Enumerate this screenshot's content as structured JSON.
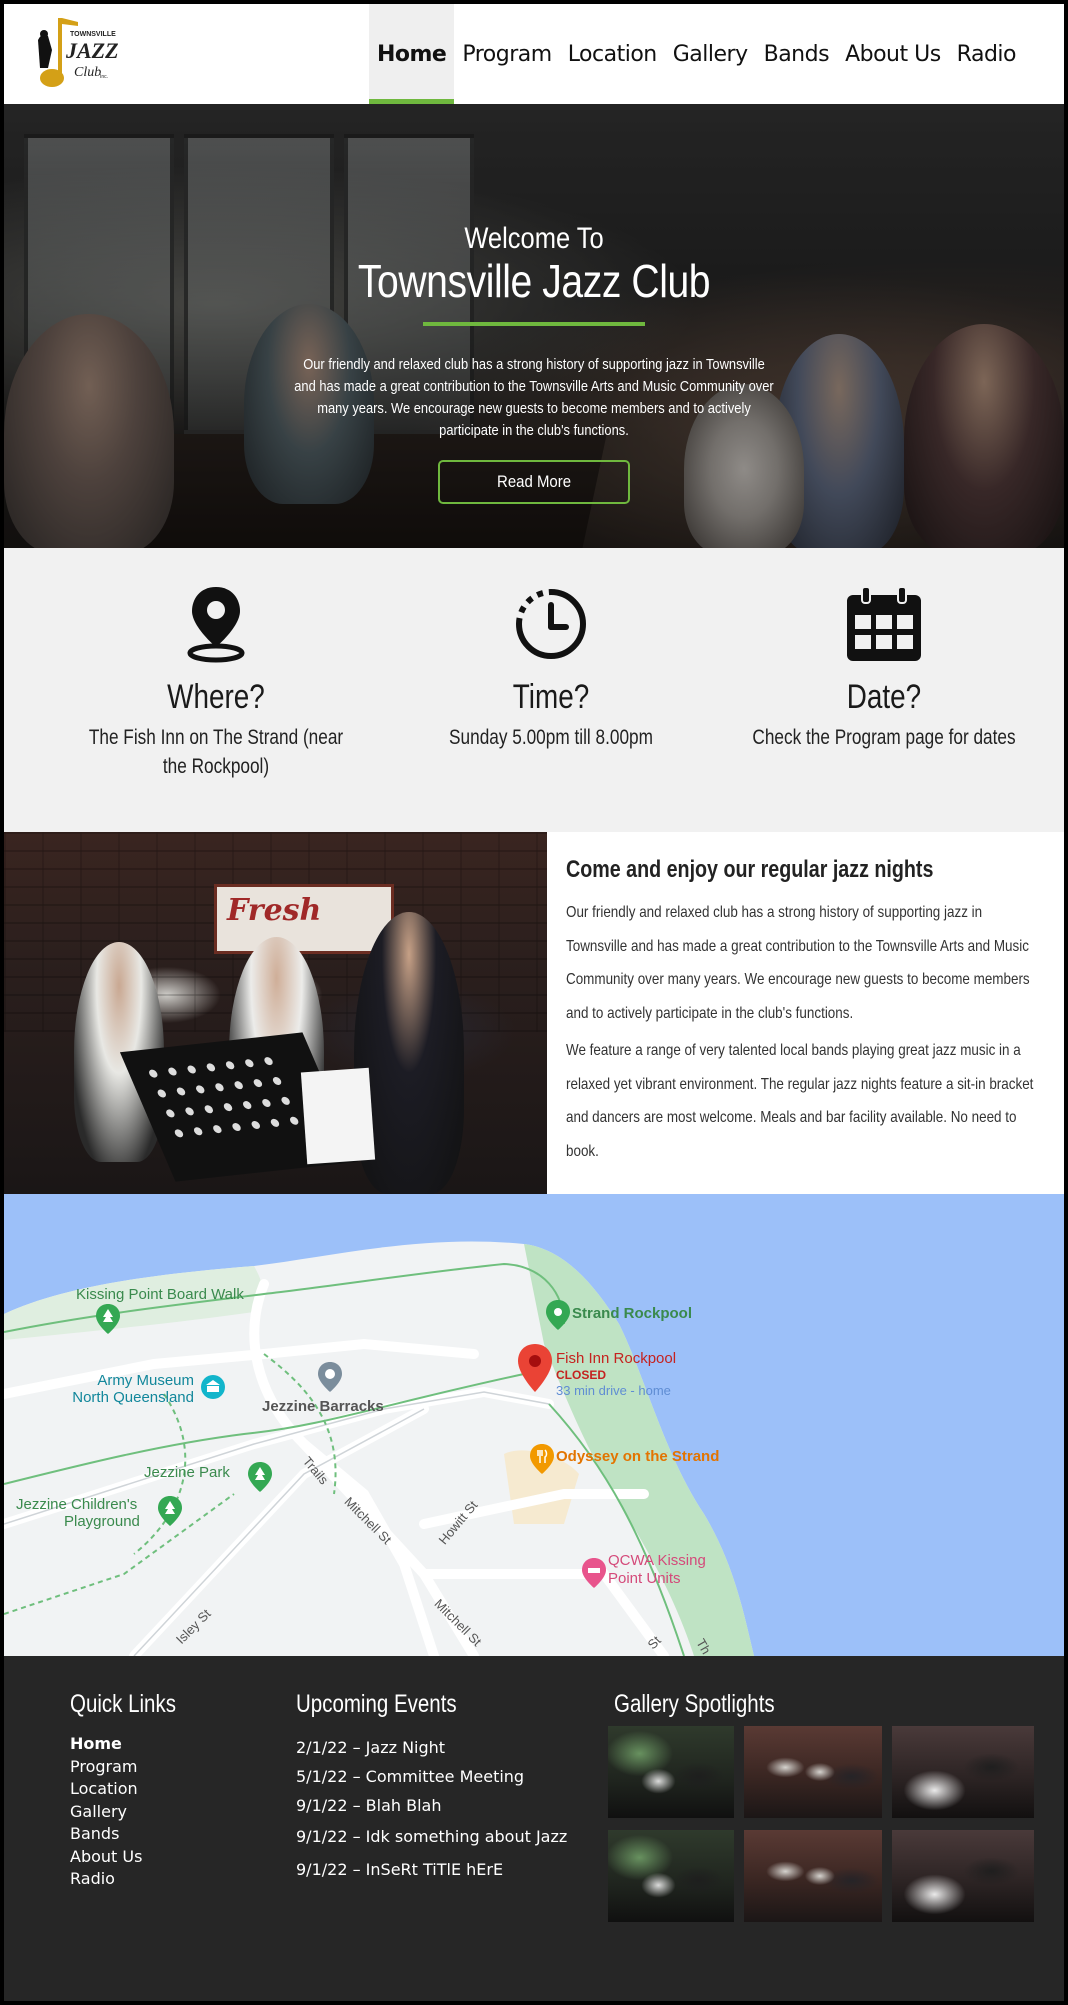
{
  "brand": {
    "logo_top": "TOWNSVILLE",
    "logo_main": "JAZZ",
    "logo_sub": "Club",
    "logo_inc": "Inc."
  },
  "nav": {
    "items": [
      {
        "label": "Home",
        "active": true
      },
      {
        "label": "Program"
      },
      {
        "label": "Location"
      },
      {
        "label": "Gallery"
      },
      {
        "label": "Bands"
      },
      {
        "label": "About Us"
      },
      {
        "label": "Radio"
      }
    ]
  },
  "hero": {
    "kicker": "Welcome To",
    "title": "Townsville Jazz Club",
    "text": "Our friendly and relaxed club has a strong history of supporting jazz in Townsville and has made a great contribution to the Townsville Arts and Music Community over many years.  We encourage new guests to become members and to actively participate in the club's functions.",
    "button": "Read More"
  },
  "info": [
    {
      "icon": "location-pin-icon",
      "title": "Where?",
      "text": "The Fish Inn on The Strand (near the Rockpool)"
    },
    {
      "icon": "clock-icon",
      "title": "Time?",
      "text": "Sunday 5.00pm till 8.00pm"
    },
    {
      "icon": "calendar-icon",
      "title": "Date?",
      "text": "Check the Program page for dates"
    }
  ],
  "feature": {
    "sign": "Fresh",
    "heading": "Come and enjoy our regular jazz nights",
    "para1": "Our friendly and relaxed club has a strong history of supporting jazz in Townsville and has made a great contribution to the Townsville Arts and Music Community over many years.  We encourage new guests to become members and to actively participate in the club's functions.",
    "para2": "We feature a range of very talented local bands playing great jazz music in a relaxed  yet vibrant environment. The regular jazz nights feature a sit-in bracket and dancers are most welcome. Meals and bar facility available. No need to book."
  },
  "map": {
    "labels": {
      "kissing_point": "Kissing Point Board Walk",
      "army_museum_1": "Army Museum",
      "army_museum_2": "North Queensland",
      "jezzine_barracks": "Jezzine Barracks",
      "strand_rockpool": "Strand Rockpool",
      "fish_inn": "Fish Inn Rockpool",
      "closed": "CLOSED",
      "drive": "33 min drive - home",
      "odyssey": "Odyssey on the Strand",
      "jezzine_park": "Jezzine Park",
      "jezzine_playground_1": "Jezzine Children's",
      "jezzine_playground_2": "Playground",
      "qcwa_1": "QCWA Kissing",
      "qcwa_2": "Point Units",
      "trails": "Trails",
      "mitchell_st_1": "Mitchell St",
      "howitt_st": "Howitt St",
      "mitchell_st_2": "Mitchell St",
      "isley_st": "Isley St",
      "st_frag": "St",
      "th_frag": "Th"
    }
  },
  "footer": {
    "quick_links_title": "Quick Links",
    "quick_links": [
      "Home",
      "Program",
      "Location",
      "Gallery",
      "Bands",
      "About Us",
      "Radio"
    ],
    "events_title": "Upcoming Events",
    "events": [
      "2/1/22 – Jazz Night",
      "5/1/22 – Committee Meeting",
      "9/1/22 – Blah Blah",
      "9/1/22 – Idk something about Jazz",
      "9/1/22 – InSeRt TiTlE hErE"
    ],
    "gallery_title": "Gallery Spotlights"
  },
  "colors": {
    "accent": "#6fb83e",
    "footer_bg": "#262626",
    "info_bg": "#f1f1f1",
    "water": "#9cc0f9"
  }
}
